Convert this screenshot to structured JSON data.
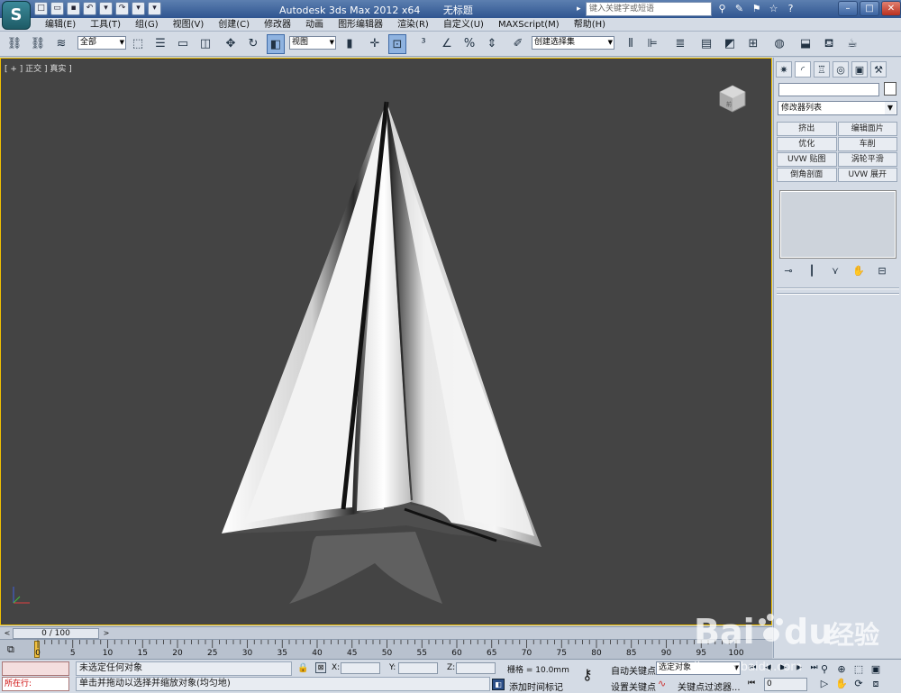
{
  "title": {
    "app": "Autodesk 3ds Max  2012 x64",
    "doc": "无标题"
  },
  "search": {
    "placeholder": "键入关键字或短语"
  },
  "app_logo": "S",
  "menu": [
    "编辑(E)",
    "工具(T)",
    "组(G)",
    "视图(V)",
    "创建(C)",
    "修改器",
    "动画",
    "图形编辑器",
    "渲染(R)",
    "自定义(U)",
    "MAXScript(M)",
    "帮助(H)"
  ],
  "toolbar": {
    "selection_filter": "全部",
    "ref_coord": "视图",
    "named_selection": "创建选择集"
  },
  "viewport": {
    "label": "[ + ] 正交 ] 真实 ]",
    "cube_label": "前"
  },
  "command_panel": {
    "modifier_list": "修改器列表",
    "modifier_buttons": [
      "挤出",
      "编辑面片",
      "优化",
      "车削",
      "UVW 贴图",
      "涡轮平滑",
      "倒角剖面",
      "UVW 展开"
    ]
  },
  "time_slider": {
    "value": "0 / 100"
  },
  "track_bar": {
    "ticks": [
      "0",
      "5",
      "10",
      "15",
      "20",
      "25",
      "30",
      "35",
      "40",
      "45",
      "50",
      "55",
      "60",
      "65",
      "70",
      "75",
      "80",
      "85",
      "90",
      "95",
      "100"
    ]
  },
  "status": {
    "maxscript_run": "所在行:",
    "selection_status": "未选定任何对象",
    "prompt": "单击并拖动以选择并缩放对象(均匀地)",
    "x_label": "X:",
    "y_label": "Y:",
    "z_label": "Z:",
    "grid": "栅格 = 10.0mm",
    "add_time_tag": "添加时间标记",
    "auto_key": "自动关键点",
    "set_key": "设置关键点",
    "key_mode": "选定对象",
    "key_filters": "关键点过滤器...",
    "current_frame": "0"
  },
  "watermark": {
    "brand": "Bai",
    "brand2": "du",
    "site_cn": "经验",
    "url": "jingyan.baidu.com"
  },
  "colors": {
    "viewport_bg": "#444444",
    "viewport_border": "#f0c000",
    "ui_bg": "#d4dbe5"
  }
}
